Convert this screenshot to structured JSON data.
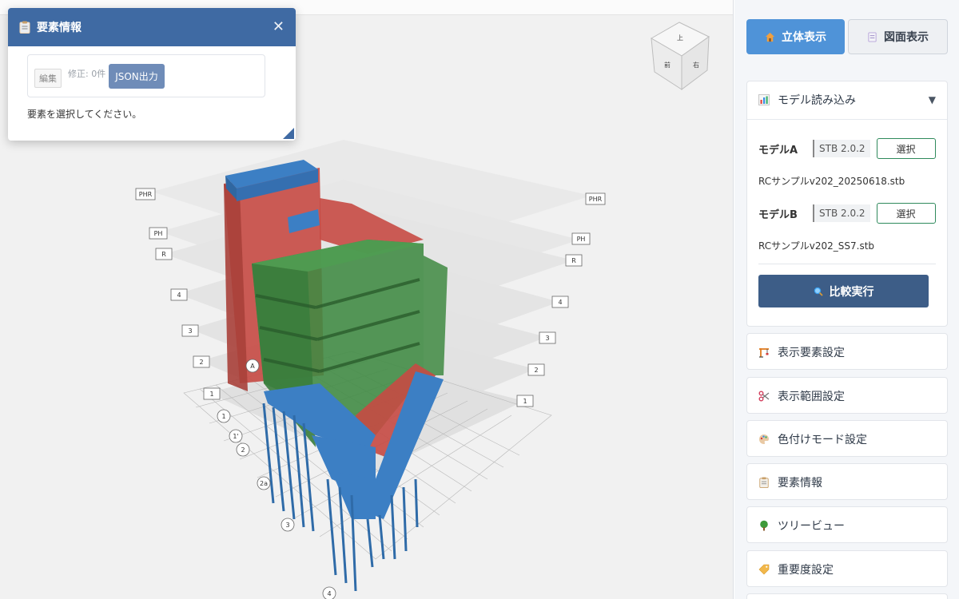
{
  "colors": {
    "panel_header": "#3f6aa3",
    "tab_active": "#4f93d8",
    "run_button": "#3d5d87",
    "select_border": "#2f8a5c",
    "struct_red": "#c74a44",
    "struct_green": "#3f8a42",
    "struct_blue": "#3c7fc4"
  },
  "info_panel": {
    "title": "要素情報",
    "icon": "clipboard-icon",
    "close_icon": "close-icon",
    "edit_label": "編集",
    "modified_count": "修正: 0件",
    "json_button": "JSON出力",
    "hint": "要素を選択してください。"
  },
  "viewport": {
    "view_cube_icon": "view-cube-icon",
    "levels_left": [
      "PHR",
      "PH",
      "R",
      "4",
      "3",
      "2",
      "1"
    ],
    "levels_right": [
      "PHR",
      "PH",
      "R",
      "4",
      "3",
      "2",
      "1"
    ],
    "grid_axes": [
      "A",
      "1",
      "1'",
      "2",
      "2a",
      "3",
      "4"
    ]
  },
  "sidebar": {
    "tabs": [
      {
        "label": "立体表示",
        "icon": "house-icon",
        "active": true
      },
      {
        "label": "図面表示",
        "icon": "document-icon",
        "active": false
      }
    ],
    "model_section": {
      "label": "モデル読み込み",
      "icon": "bar-chart-icon",
      "arrow": "▼",
      "models": [
        {
          "label": "モデルA",
          "version": "STB 2.0.2",
          "select": "選択",
          "file": "RCサンプルv202_20250618.stb"
        },
        {
          "label": "モデルB",
          "version": "STB 2.0.2",
          "select": "選択",
          "file": "RCサンプルv202_SS7.stb"
        }
      ],
      "run_label": "比較実行",
      "run_icon": "magnifier-icon"
    },
    "menu": [
      {
        "label": "表示要素設定",
        "icon": "crane-icon"
      },
      {
        "label": "表示範囲設定",
        "icon": "scissors-icon"
      },
      {
        "label": "色付けモード設定",
        "icon": "palette-icon"
      },
      {
        "label": "要素情報",
        "icon": "clipboard-icon"
      },
      {
        "label": "ツリービュー",
        "icon": "tree-icon"
      },
      {
        "label": "重要度設定",
        "icon": "tag-icon"
      }
    ]
  }
}
